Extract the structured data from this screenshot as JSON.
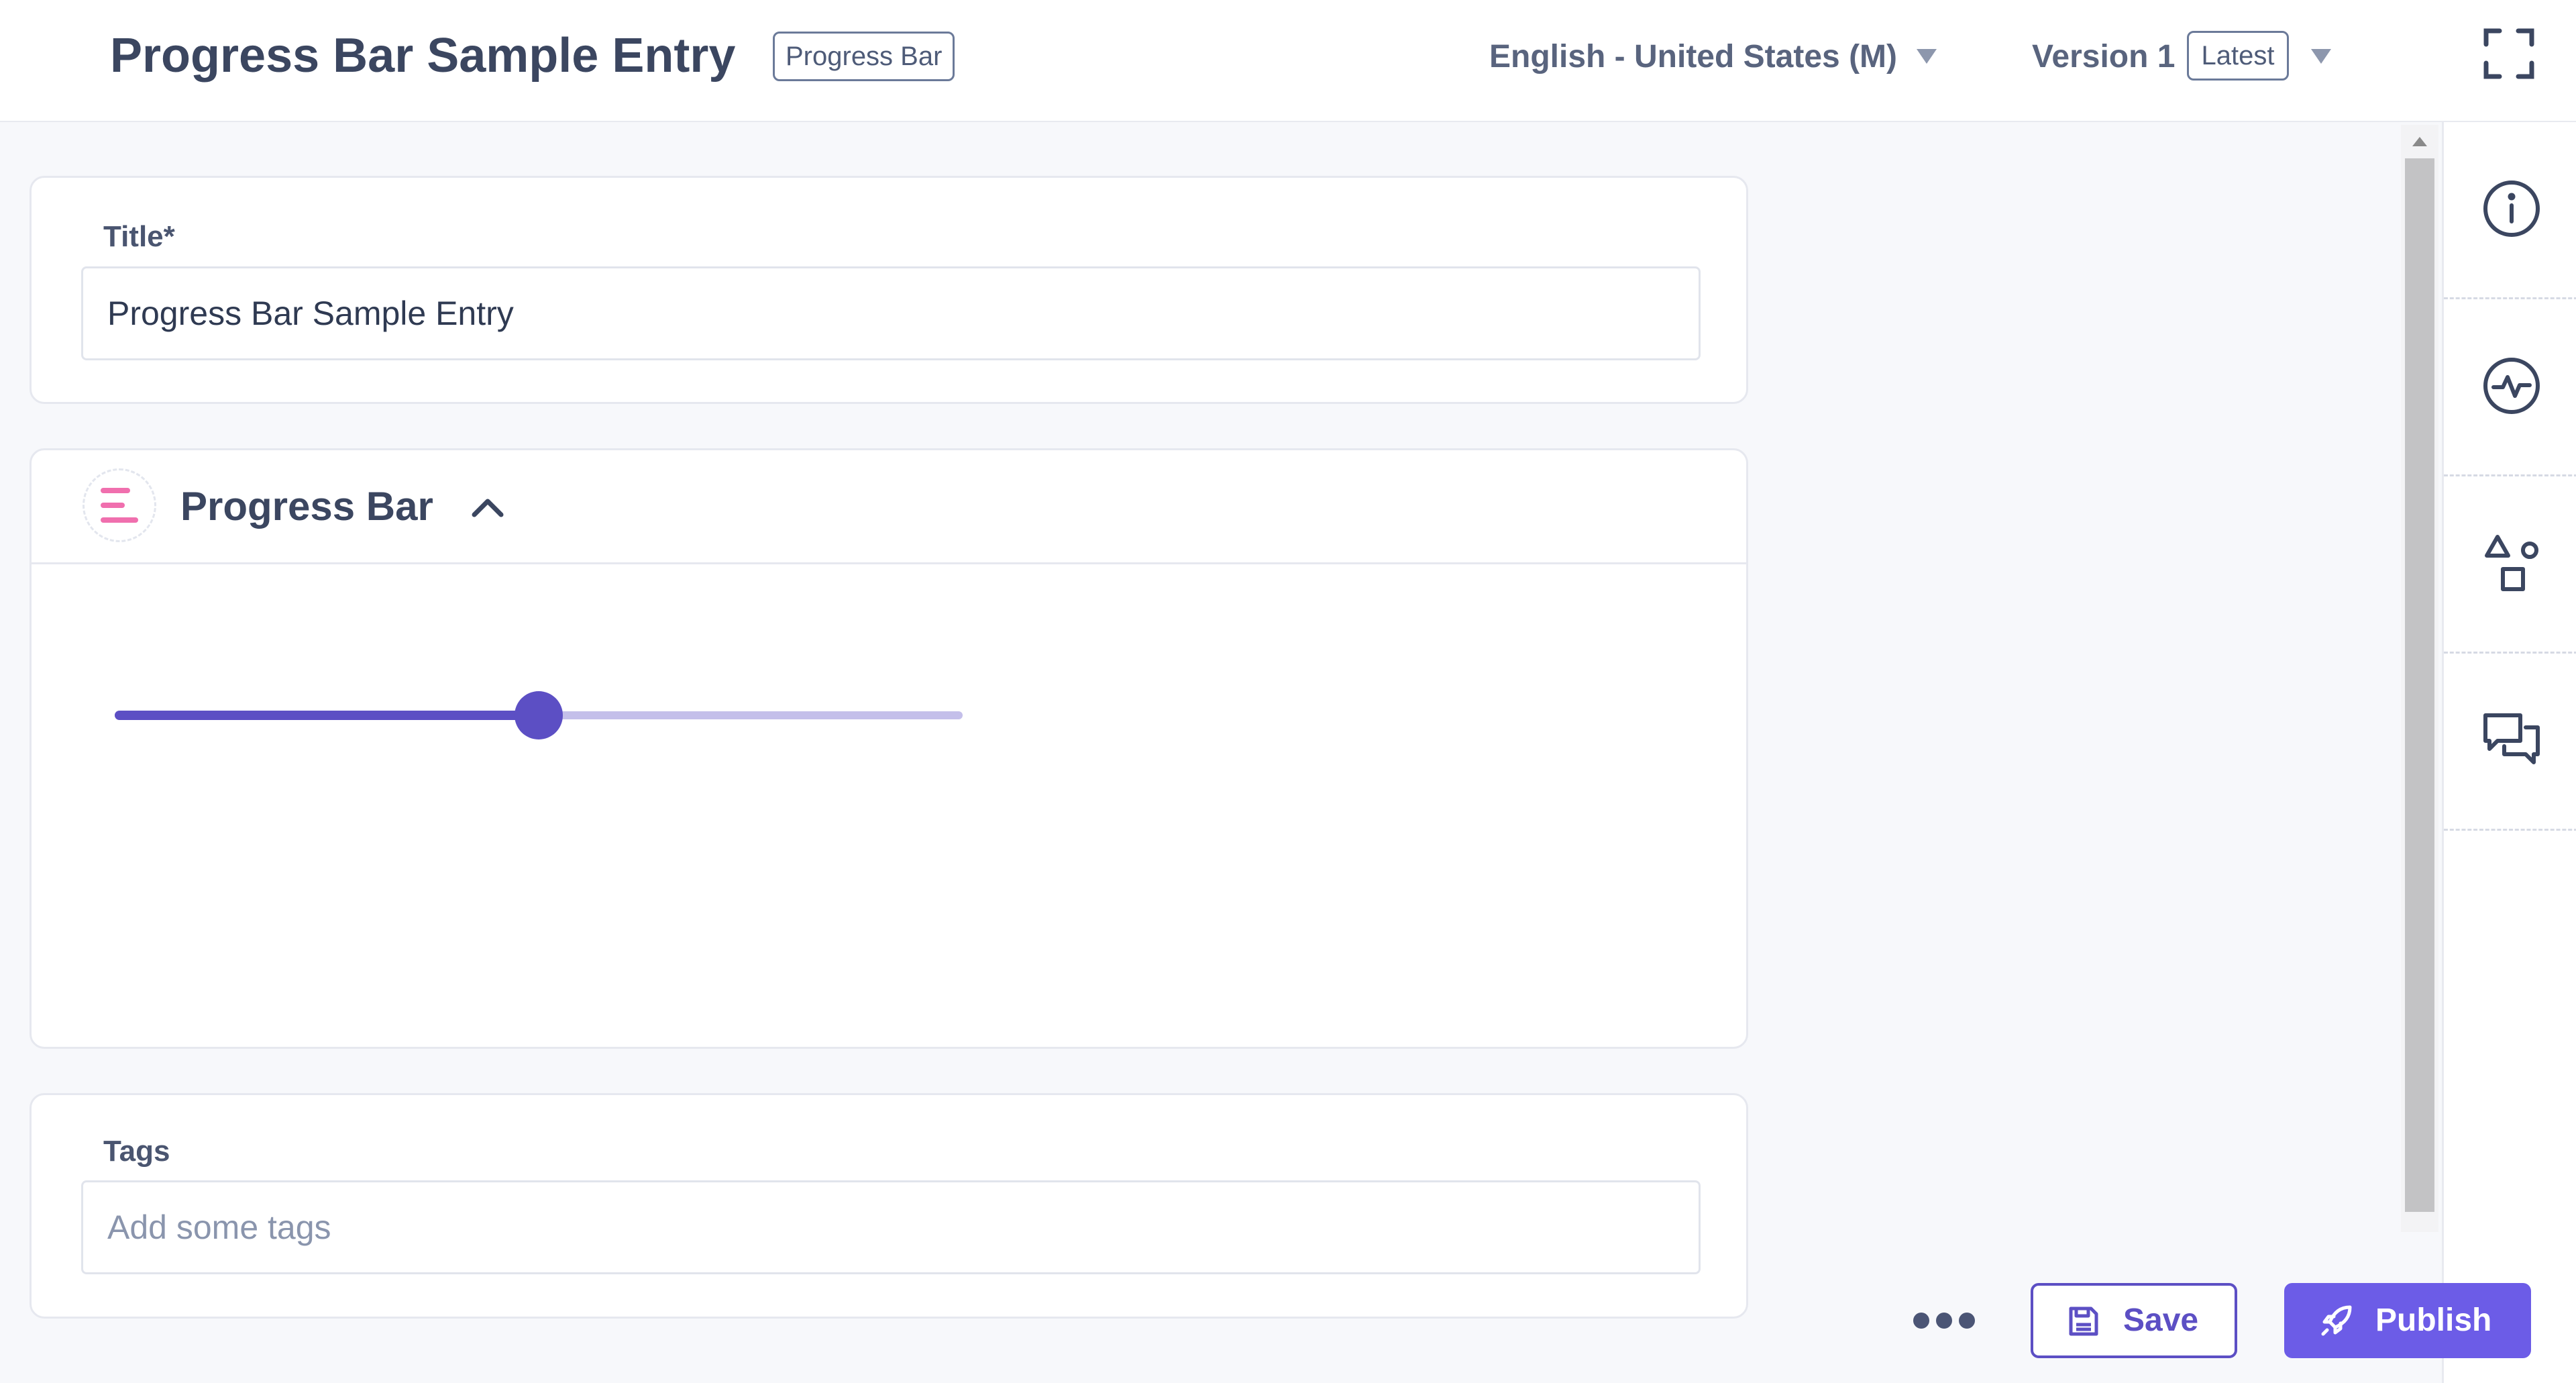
{
  "header": {
    "title": "Progress Bar Sample Entry",
    "content_type_badge": "Progress Bar",
    "locale": "English - United States (M)",
    "version": "Version 1",
    "version_badge": "Latest"
  },
  "title_field": {
    "label": "Title*",
    "value": "Progress Bar Sample Entry"
  },
  "progress_group": {
    "title": "Progress Bar",
    "slider_value_percent": 50
  },
  "tags_field": {
    "label": "Tags",
    "placeholder": "Add some tags"
  },
  "actions": {
    "save_label": "Save",
    "publish_label": "Publish"
  },
  "icons": {
    "fullscreen": "fullscreen-icon",
    "group": "group-lines-icon",
    "collapse": "chevron-up-icon",
    "info": "info-icon",
    "activity": "activity-icon",
    "shapes": "shapes-icon",
    "comments": "comments-icon",
    "more": "more-dots-icon",
    "save": "floppy-icon",
    "publish": "rocket-icon"
  },
  "colors": {
    "primary": "#6c5ce7",
    "slider": "#5c4fc4",
    "slider_rail": "#c4bfea",
    "group_icon": "#f06fae"
  }
}
